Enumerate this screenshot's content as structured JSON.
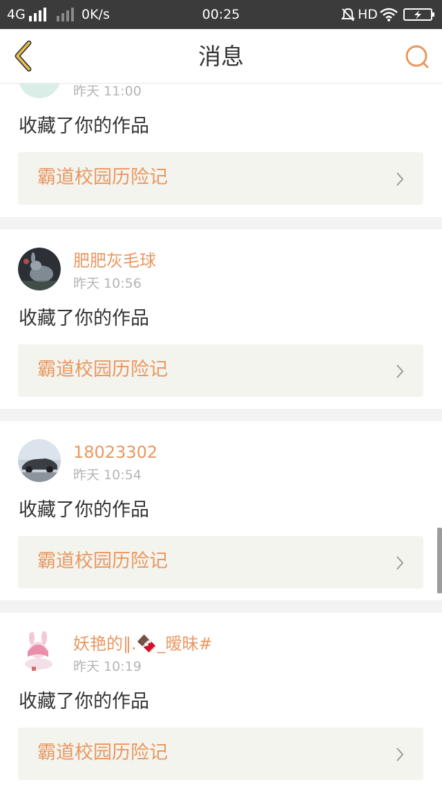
{
  "status_bar": {
    "network": "4G",
    "speed": "0K/s",
    "time": "00:25",
    "hd": "HD",
    "icons": [
      "signal-icon",
      "signal-weak-icon",
      "mute-icon",
      "wifi-icon",
      "battery-charging-icon"
    ]
  },
  "header": {
    "title": "消息",
    "back_icon": "chevron-left-icon",
    "search_icon": "search-icon",
    "accent": "#e99760"
  },
  "messages": [
    {
      "username": "",
      "time": "昨天 11:00",
      "action": "收藏了你的作品",
      "work": "霸道校园历险记",
      "avatar": "avatar-green-text"
    },
    {
      "username": "肥肥灰毛球",
      "time": "昨天 10:56",
      "action": "收藏了你的作品",
      "work": "霸道校园历险记",
      "avatar": "avatar-rabbit"
    },
    {
      "username": "18023302",
      "time": "昨天 10:54",
      "action": "收藏了你的作品",
      "work": "霸道校园历险记",
      "avatar": "avatar-car"
    },
    {
      "username": "妖艳的‖.🍫_暧昧#",
      "time": "昨天 10:19",
      "action": "收藏了你的作品",
      "work": "霸道校园历险记",
      "avatar": "avatar-anime-girl"
    }
  ]
}
